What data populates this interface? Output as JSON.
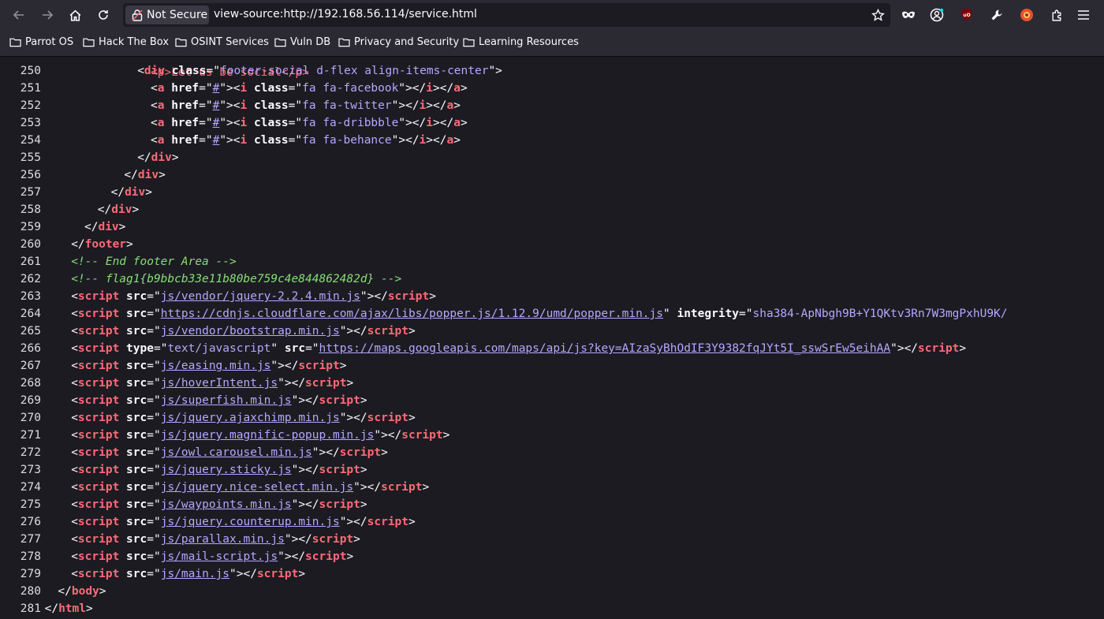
{
  "browser": {
    "security_label": "Not Secure",
    "url": "view-source:http://192.168.56.114/service.html",
    "icons": [
      "back-icon",
      "forward-icon",
      "home-icon",
      "reload-icon",
      "lock-warning-icon",
      "star-icon",
      "mask-icon",
      "account-icon",
      "ublock-icon",
      "wrench-icon",
      "extension-red-icon",
      "puzzle-icon",
      "menu-icon"
    ]
  },
  "bookmarks": [
    "Parrot OS",
    "Hack The Box",
    "OSINT Services",
    "Vuln DB",
    "Privacy and Security",
    "Learning Resources"
  ],
  "colors": {
    "tag": "#ff6a77",
    "attr_value": "#b4a8ff",
    "comment": "#86de74",
    "background": "#1c1b22"
  },
  "source": {
    "partial_first_line": "<p>Let us be social</p>",
    "lines": [
      {
        "n": "250",
        "i": 4,
        "p": [
          [
            "p",
            "<"
          ],
          [
            "t",
            "div"
          ],
          [
            "p",
            " "
          ],
          [
            "a",
            "class"
          ],
          [
            "p",
            "=\""
          ],
          [
            "v",
            "footer-social d-flex align-items-center"
          ],
          [
            "p",
            "\">"
          ]
        ]
      },
      {
        "n": "251",
        "i": 5,
        "p": [
          [
            "p",
            "<"
          ],
          [
            "t",
            "a"
          ],
          [
            "p",
            " "
          ],
          [
            "a",
            "href"
          ],
          [
            "p",
            "=\""
          ],
          [
            "l",
            "#"
          ],
          [
            "p",
            "\"><"
          ],
          [
            "t",
            "i"
          ],
          [
            "p",
            " "
          ],
          [
            "a",
            "class"
          ],
          [
            "p",
            "=\""
          ],
          [
            "v",
            "fa fa-facebook"
          ],
          [
            "p",
            "\"></"
          ],
          [
            "t",
            "i"
          ],
          [
            "p",
            "></"
          ],
          [
            "t",
            "a"
          ],
          [
            "p",
            ">"
          ]
        ]
      },
      {
        "n": "252",
        "i": 5,
        "p": [
          [
            "p",
            "<"
          ],
          [
            "t",
            "a"
          ],
          [
            "p",
            " "
          ],
          [
            "a",
            "href"
          ],
          [
            "p",
            "=\""
          ],
          [
            "l",
            "#"
          ],
          [
            "p",
            "\"><"
          ],
          [
            "t",
            "i"
          ],
          [
            "p",
            " "
          ],
          [
            "a",
            "class"
          ],
          [
            "p",
            "=\""
          ],
          [
            "v",
            "fa fa-twitter"
          ],
          [
            "p",
            "\"></"
          ],
          [
            "t",
            "i"
          ],
          [
            "p",
            "></"
          ],
          [
            "t",
            "a"
          ],
          [
            "p",
            ">"
          ]
        ]
      },
      {
        "n": "253",
        "i": 5,
        "p": [
          [
            "p",
            "<"
          ],
          [
            "t",
            "a"
          ],
          [
            "p",
            " "
          ],
          [
            "a",
            "href"
          ],
          [
            "p",
            "=\""
          ],
          [
            "l",
            "#"
          ],
          [
            "p",
            "\"><"
          ],
          [
            "t",
            "i"
          ],
          [
            "p",
            " "
          ],
          [
            "a",
            "class"
          ],
          [
            "p",
            "=\""
          ],
          [
            "v",
            "fa fa-dribbble"
          ],
          [
            "p",
            "\"></"
          ],
          [
            "t",
            "i"
          ],
          [
            "p",
            "></"
          ],
          [
            "t",
            "a"
          ],
          [
            "p",
            ">"
          ]
        ]
      },
      {
        "n": "254",
        "i": 5,
        "p": [
          [
            "p",
            "<"
          ],
          [
            "t",
            "a"
          ],
          [
            "p",
            " "
          ],
          [
            "a",
            "href"
          ],
          [
            "p",
            "=\""
          ],
          [
            "l",
            "#"
          ],
          [
            "p",
            "\"><"
          ],
          [
            "t",
            "i"
          ],
          [
            "p",
            " "
          ],
          [
            "a",
            "class"
          ],
          [
            "p",
            "=\""
          ],
          [
            "v",
            "fa fa-behance"
          ],
          [
            "p",
            "\"></"
          ],
          [
            "t",
            "i"
          ],
          [
            "p",
            "></"
          ],
          [
            "t",
            "a"
          ],
          [
            "p",
            ">"
          ]
        ]
      },
      {
        "n": "255",
        "i": 4,
        "p": [
          [
            "p",
            "</"
          ],
          [
            "t",
            "div"
          ],
          [
            "p",
            ">"
          ]
        ]
      },
      {
        "n": "256",
        "i": 3,
        "p": [
          [
            "p",
            "</"
          ],
          [
            "t",
            "div"
          ],
          [
            "p",
            ">"
          ]
        ]
      },
      {
        "n": "257",
        "i": 2,
        "p": [
          [
            "p",
            "</"
          ],
          [
            "t",
            "div"
          ],
          [
            "p",
            ">"
          ]
        ]
      },
      {
        "n": "258",
        "i": 1,
        "p": [
          [
            "p",
            "</"
          ],
          [
            "t",
            "div"
          ],
          [
            "p",
            ">"
          ]
        ]
      },
      {
        "n": "259",
        "i": 0,
        "p": [
          [
            "p",
            "</"
          ],
          [
            "t",
            "div"
          ],
          [
            "p",
            ">"
          ]
        ]
      },
      {
        "n": "260",
        "i": -1,
        "p": [
          [
            "p",
            "</"
          ],
          [
            "t",
            "footer"
          ],
          [
            "p",
            ">"
          ]
        ]
      },
      {
        "n": "261",
        "i": -1,
        "p": [
          [
            "c",
            "<!-- End footer Area -->"
          ]
        ]
      },
      {
        "n": "262",
        "i": -1,
        "p": [
          [
            "c",
            "<!-- flag1{b9bbcb33e11b80be759c4e844862482d} -->"
          ]
        ]
      },
      {
        "n": "263",
        "i": -1,
        "p": [
          [
            "p",
            "<"
          ],
          [
            "t",
            "script"
          ],
          [
            "p",
            " "
          ],
          [
            "a",
            "src"
          ],
          [
            "p",
            "=\""
          ],
          [
            "l",
            "js/vendor/jquery-2.2.4.min.js"
          ],
          [
            "p",
            "\"></"
          ],
          [
            "t",
            "script"
          ],
          [
            "p",
            ">"
          ]
        ]
      },
      {
        "n": "264",
        "i": -1,
        "p": [
          [
            "p",
            "<"
          ],
          [
            "t",
            "script"
          ],
          [
            "p",
            " "
          ],
          [
            "a",
            "src"
          ],
          [
            "p",
            "=\""
          ],
          [
            "l",
            "https://cdnjs.cloudflare.com/ajax/libs/popper.js/1.12.9/umd/popper.min.js"
          ],
          [
            "p",
            "\" "
          ],
          [
            "a",
            "integrity"
          ],
          [
            "p",
            "=\""
          ],
          [
            "v",
            "sha384-ApNbgh9B+Y1QKtv3Rn7W3mgPxhU9K/"
          ]
        ]
      },
      {
        "n": "265",
        "i": -1,
        "p": [
          [
            "p",
            "<"
          ],
          [
            "t",
            "script"
          ],
          [
            "p",
            " "
          ],
          [
            "a",
            "src"
          ],
          [
            "p",
            "=\""
          ],
          [
            "l",
            "js/vendor/bootstrap.min.js"
          ],
          [
            "p",
            "\"></"
          ],
          [
            "t",
            "script"
          ],
          [
            "p",
            ">"
          ]
        ]
      },
      {
        "n": "266",
        "i": -1,
        "p": [
          [
            "p",
            "<"
          ],
          [
            "t",
            "script"
          ],
          [
            "p",
            " "
          ],
          [
            "a",
            "type"
          ],
          [
            "p",
            "=\""
          ],
          [
            "v",
            "text/javascript"
          ],
          [
            "p",
            "\" "
          ],
          [
            "a",
            "src"
          ],
          [
            "p",
            "=\""
          ],
          [
            "l",
            "https://maps.googleapis.com/maps/api/js?key=AIzaSyBhOdIF3Y9382fqJYt5I_sswSrEw5eihAA"
          ],
          [
            "p",
            "\"></"
          ],
          [
            "t",
            "script"
          ],
          [
            "p",
            ">"
          ]
        ]
      },
      {
        "n": "267",
        "i": -1,
        "p": [
          [
            "p",
            "<"
          ],
          [
            "t",
            "script"
          ],
          [
            "p",
            " "
          ],
          [
            "a",
            "src"
          ],
          [
            "p",
            "=\""
          ],
          [
            "l",
            "js/easing.min.js"
          ],
          [
            "p",
            "\"></"
          ],
          [
            "t",
            "script"
          ],
          [
            "p",
            ">"
          ]
        ]
      },
      {
        "n": "268",
        "i": -1,
        "p": [
          [
            "p",
            "<"
          ],
          [
            "t",
            "script"
          ],
          [
            "p",
            " "
          ],
          [
            "a",
            "src"
          ],
          [
            "p",
            "=\""
          ],
          [
            "l",
            "js/hoverIntent.js"
          ],
          [
            "p",
            "\"></"
          ],
          [
            "t",
            "script"
          ],
          [
            "p",
            ">"
          ]
        ]
      },
      {
        "n": "269",
        "i": -1,
        "p": [
          [
            "p",
            "<"
          ],
          [
            "t",
            "script"
          ],
          [
            "p",
            " "
          ],
          [
            "a",
            "src"
          ],
          [
            "p",
            "=\""
          ],
          [
            "l",
            "js/superfish.min.js"
          ],
          [
            "p",
            "\"></"
          ],
          [
            "t",
            "script"
          ],
          [
            "p",
            ">"
          ]
        ]
      },
      {
        "n": "270",
        "i": -1,
        "p": [
          [
            "p",
            "<"
          ],
          [
            "t",
            "script"
          ],
          [
            "p",
            " "
          ],
          [
            "a",
            "src"
          ],
          [
            "p",
            "=\""
          ],
          [
            "l",
            "js/jquery.ajaxchimp.min.js"
          ],
          [
            "p",
            "\"></"
          ],
          [
            "t",
            "script"
          ],
          [
            "p",
            ">"
          ]
        ]
      },
      {
        "n": "271",
        "i": -1,
        "p": [
          [
            "p",
            "<"
          ],
          [
            "t",
            "script"
          ],
          [
            "p",
            " "
          ],
          [
            "a",
            "src"
          ],
          [
            "p",
            "=\""
          ],
          [
            "l",
            "js/jquery.magnific-popup.min.js"
          ],
          [
            "p",
            "\"></"
          ],
          [
            "t",
            "script"
          ],
          [
            "p",
            ">"
          ]
        ]
      },
      {
        "n": "272",
        "i": -1,
        "p": [
          [
            "p",
            "<"
          ],
          [
            "t",
            "script"
          ],
          [
            "p",
            " "
          ],
          [
            "a",
            "src"
          ],
          [
            "p",
            "=\""
          ],
          [
            "l",
            "js/owl.carousel.min.js"
          ],
          [
            "p",
            "\"></"
          ],
          [
            "t",
            "script"
          ],
          [
            "p",
            ">"
          ]
        ]
      },
      {
        "n": "273",
        "i": -1,
        "p": [
          [
            "p",
            "<"
          ],
          [
            "t",
            "script"
          ],
          [
            "p",
            " "
          ],
          [
            "a",
            "src"
          ],
          [
            "p",
            "=\""
          ],
          [
            "l",
            "js/jquery.sticky.js"
          ],
          [
            "p",
            "\"></"
          ],
          [
            "t",
            "script"
          ],
          [
            "p",
            ">"
          ]
        ]
      },
      {
        "n": "274",
        "i": -1,
        "p": [
          [
            "p",
            "<"
          ],
          [
            "t",
            "script"
          ],
          [
            "p",
            " "
          ],
          [
            "a",
            "src"
          ],
          [
            "p",
            "=\""
          ],
          [
            "l",
            "js/jquery.nice-select.min.js"
          ],
          [
            "p",
            "\"></"
          ],
          [
            "t",
            "script"
          ],
          [
            "p",
            ">"
          ]
        ]
      },
      {
        "n": "275",
        "i": -1,
        "p": [
          [
            "p",
            "<"
          ],
          [
            "t",
            "script"
          ],
          [
            "p",
            " "
          ],
          [
            "a",
            "src"
          ],
          [
            "p",
            "=\""
          ],
          [
            "l",
            "js/waypoints.min.js"
          ],
          [
            "p",
            "\"></"
          ],
          [
            "t",
            "script"
          ],
          [
            "p",
            ">"
          ]
        ]
      },
      {
        "n": "276",
        "i": -1,
        "p": [
          [
            "p",
            "<"
          ],
          [
            "t",
            "script"
          ],
          [
            "p",
            " "
          ],
          [
            "a",
            "src"
          ],
          [
            "p",
            "=\""
          ],
          [
            "l",
            "js/jquery.counterup.min.js"
          ],
          [
            "p",
            "\"></"
          ],
          [
            "t",
            "script"
          ],
          [
            "p",
            ">"
          ]
        ]
      },
      {
        "n": "277",
        "i": -1,
        "p": [
          [
            "p",
            "<"
          ],
          [
            "t",
            "script"
          ],
          [
            "p",
            " "
          ],
          [
            "a",
            "src"
          ],
          [
            "p",
            "=\""
          ],
          [
            "l",
            "js/parallax.min.js"
          ],
          [
            "p",
            "\"></"
          ],
          [
            "t",
            "script"
          ],
          [
            "p",
            ">"
          ]
        ]
      },
      {
        "n": "278",
        "i": -1,
        "p": [
          [
            "p",
            "<"
          ],
          [
            "t",
            "script"
          ],
          [
            "p",
            " "
          ],
          [
            "a",
            "src"
          ],
          [
            "p",
            "=\""
          ],
          [
            "l",
            "js/mail-script.js"
          ],
          [
            "p",
            "\"></"
          ],
          [
            "t",
            "script"
          ],
          [
            "p",
            ">"
          ]
        ]
      },
      {
        "n": "279",
        "i": -1,
        "p": [
          [
            "p",
            "<"
          ],
          [
            "t",
            "script"
          ],
          [
            "p",
            " "
          ],
          [
            "a",
            "src"
          ],
          [
            "p",
            "=\""
          ],
          [
            "l",
            "js/main.js"
          ],
          [
            "p",
            "\"></"
          ],
          [
            "t",
            "script"
          ],
          [
            "p",
            ">"
          ]
        ]
      },
      {
        "n": "280",
        "i": -2,
        "p": [
          [
            "p",
            "</"
          ],
          [
            "t",
            "body"
          ],
          [
            "p",
            ">"
          ]
        ]
      },
      {
        "n": "281",
        "i": -3,
        "p": [
          [
            "p",
            "</"
          ],
          [
            "t",
            "html"
          ],
          [
            "p",
            ">"
          ]
        ]
      }
    ]
  }
}
